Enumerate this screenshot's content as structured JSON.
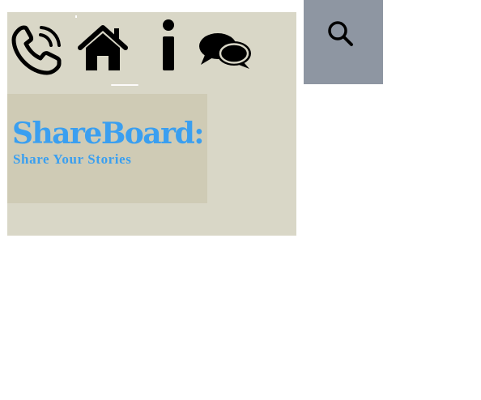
{
  "nav": {
    "items": [
      {
        "icon": "phone-icon"
      },
      {
        "icon": "home-icon"
      },
      {
        "icon": "info-icon"
      },
      {
        "icon": "chat-icon"
      }
    ]
  },
  "banner": {
    "title": "ShareBoard:",
    "subtitle": "Share Your Stories"
  },
  "search": {
    "icon": "search-icon"
  },
  "colors": {
    "panel": "#d9d7c7",
    "banner_bg": "#cfcbb5",
    "brand_blue": "#3a9ff0",
    "search_bg": "#8e96a2"
  }
}
